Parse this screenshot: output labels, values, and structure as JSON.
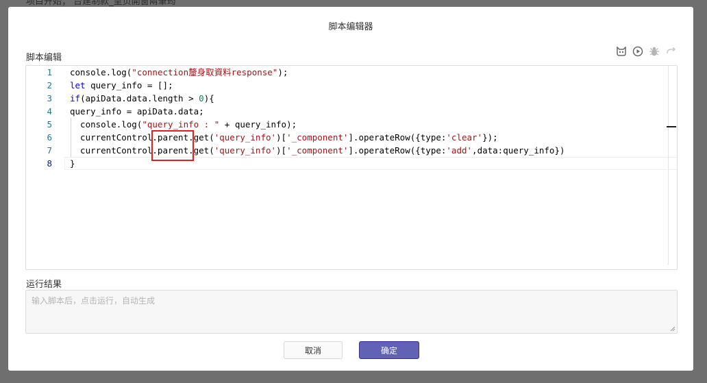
{
  "background": {
    "partial_text": "项目开始；  台建制款_呈页開窗兩筆筠"
  },
  "modal": {
    "title": "脚本编辑器",
    "editor_label": "脚本编辑",
    "result_label": "运行结果",
    "result_placeholder": "输入脚本后，点击运行，自动生成",
    "cancel_label": "取消",
    "ok_label": "确定",
    "toolbar_icons": [
      "cat-face-icon",
      "play-circle-icon",
      "bug-icon",
      "redo-icon"
    ]
  },
  "code": {
    "line_numbers": [
      "1",
      "2",
      "3",
      "4",
      "5",
      "6",
      "7",
      "8"
    ],
    "lines": [
      "console.log(\"connection釐身取資料response\");",
      "let query_info = [];",
      "if(apiData.data.length > 0){",
      "query_info = apiData.data;",
      "  console.log(\"query_info : \" + query_info);",
      "  currentControl.parent.get('query_info')['_component'].operateRow({type:'clear'});",
      "  currentControl.parent.get('query_info')['_component'].operateRow({type:'add',data:query_info})",
      "}"
    ]
  },
  "colors": {
    "accent": "#6161b5",
    "highlight": "#e02020",
    "line_number": "#237893",
    "keyword": "#0000ff",
    "string": "#a31515"
  }
}
